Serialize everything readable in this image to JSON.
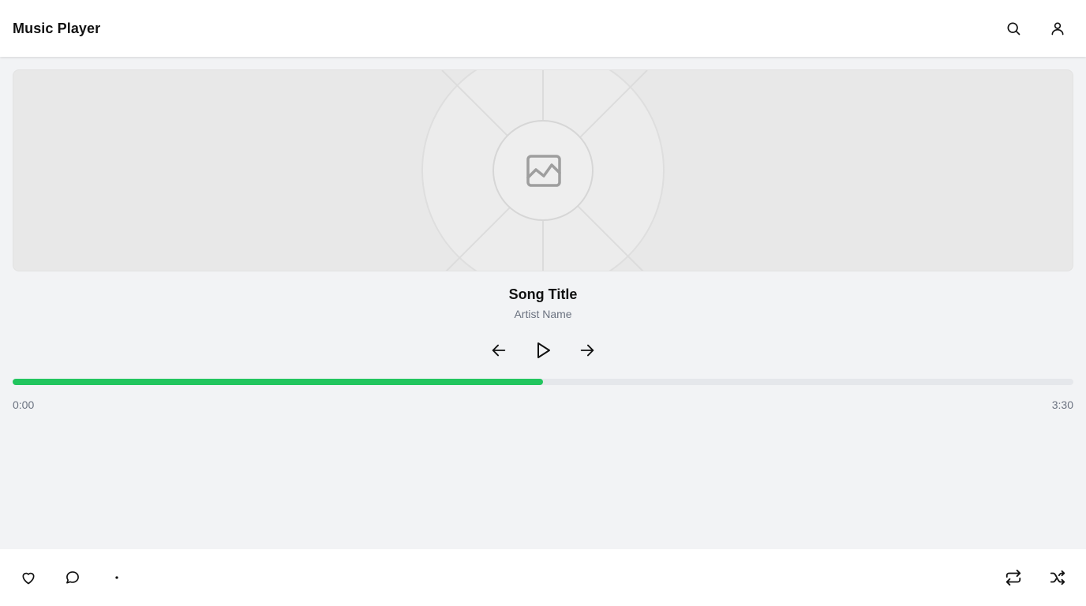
{
  "header": {
    "title": "Music Player",
    "icons": [
      "search-icon",
      "user-icon"
    ]
  },
  "artwork": {
    "icon": "image-placeholder-icon"
  },
  "track": {
    "title": "Song Title",
    "artist": "Artist Name",
    "current_time": "0:00",
    "total_time": "3:30",
    "progress": 0.5
  },
  "controls": {
    "icons": [
      "arrow-left-icon",
      "play-icon",
      "arrow-right-icon"
    ]
  },
  "footer": {
    "left_icons": [
      "heart-icon",
      "comment-icon",
      "dot-icon"
    ],
    "right_icons": [
      "repeat-icon",
      "shuffle-icon"
    ]
  },
  "colors": {
    "accent": "#22c55e",
    "track": "#e5e7eb",
    "muted_text": "#6b7280",
    "background": "#f2f3f5"
  }
}
